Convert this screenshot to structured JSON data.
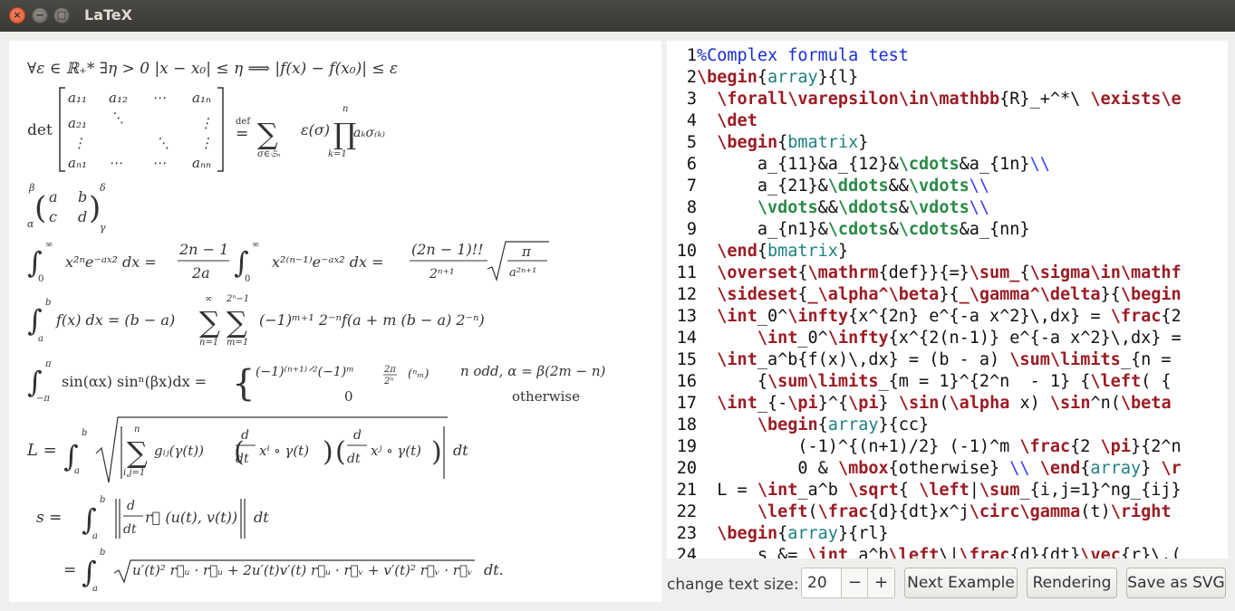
{
  "window": {
    "title": "LaTeX"
  },
  "editor": {
    "lines": [
      {
        "n": "1",
        "segs": [
          [
            "c-cmt",
            "%Complex formula test"
          ]
        ]
      },
      {
        "n": "2",
        "segs": [
          [
            "c-kw",
            "\\begin"
          ],
          [
            "code",
            "{"
          ],
          [
            "c-env",
            "array"
          ],
          [
            "code",
            "}{l}"
          ]
        ]
      },
      {
        "n": "3",
        "segs": [
          [
            "code",
            "  "
          ],
          [
            "c-kw",
            "\\forall\\varepsilon\\in\\mathbb"
          ],
          [
            "code",
            "{R}_+^*\\ "
          ],
          [
            "c-kw",
            "\\exists\\e"
          ]
        ]
      },
      {
        "n": "4",
        "segs": [
          [
            "code",
            "  "
          ],
          [
            "c-kw",
            "\\det"
          ]
        ]
      },
      {
        "n": "5",
        "segs": [
          [
            "code",
            "  "
          ],
          [
            "c-kw",
            "\\begin"
          ],
          [
            "code",
            "{"
          ],
          [
            "c-env",
            "bmatrix"
          ],
          [
            "code",
            "}"
          ]
        ]
      },
      {
        "n": "6",
        "segs": [
          [
            "code",
            "      a_{11}&a_{12}&"
          ],
          [
            "c-sym",
            "\\cdots"
          ],
          [
            "code",
            "&a_{1n}"
          ],
          [
            "c-br",
            "\\\\"
          ]
        ]
      },
      {
        "n": "7",
        "segs": [
          [
            "code",
            "      a_{21}&"
          ],
          [
            "c-sym",
            "\\ddots"
          ],
          [
            "code",
            "&&"
          ],
          [
            "c-sym",
            "\\vdots"
          ],
          [
            "c-br",
            "\\\\"
          ]
        ]
      },
      {
        "n": "8",
        "segs": [
          [
            "code",
            "      "
          ],
          [
            "c-sym",
            "\\vdots"
          ],
          [
            "code",
            "&&"
          ],
          [
            "c-sym",
            "\\ddots"
          ],
          [
            "code",
            "&"
          ],
          [
            "c-sym",
            "\\vdots"
          ],
          [
            "c-br",
            "\\\\"
          ]
        ]
      },
      {
        "n": "9",
        "segs": [
          [
            "code",
            "      a_{n1}&"
          ],
          [
            "c-sym",
            "\\cdots"
          ],
          [
            "code",
            "&"
          ],
          [
            "c-sym",
            "\\cdots"
          ],
          [
            "code",
            "&a_{nn}"
          ]
        ]
      },
      {
        "n": "10",
        "segs": [
          [
            "code",
            "  "
          ],
          [
            "c-kw",
            "\\end"
          ],
          [
            "code",
            "{"
          ],
          [
            "c-env",
            "bmatrix"
          ],
          [
            "code",
            "}"
          ]
        ]
      },
      {
        "n": "11",
        "segs": [
          [
            "code",
            "  "
          ],
          [
            "c-kw",
            "\\overset"
          ],
          [
            "code",
            "{"
          ],
          [
            "c-kw",
            "\\mathrm"
          ],
          [
            "code",
            "{def}}{=}"
          ],
          [
            "c-kw",
            "\\sum_"
          ],
          [
            "code",
            "{"
          ],
          [
            "c-kw",
            "\\sigma\\in\\mathf"
          ]
        ]
      },
      {
        "n": "12",
        "segs": [
          [
            "code",
            "  "
          ],
          [
            "c-kw",
            "\\sideset"
          ],
          [
            "code",
            "{"
          ],
          [
            "c-kw",
            "_\\alpha^\\beta"
          ],
          [
            "code",
            "}{"
          ],
          [
            "c-kw",
            "_\\gamma^\\delta"
          ],
          [
            "code",
            "}{"
          ],
          [
            "c-kw",
            "\\begin"
          ]
        ]
      },
      {
        "n": "13",
        "segs": [
          [
            "code",
            "  "
          ],
          [
            "c-kw",
            "\\int"
          ],
          [
            "code",
            "_0^"
          ],
          [
            "c-kw",
            "\\infty"
          ],
          [
            "code",
            "{x^{2n} e^{-a x^2}\\,dx} = "
          ],
          [
            "c-kw",
            "\\frac"
          ],
          [
            "code",
            "{2"
          ]
        ]
      },
      {
        "n": "14",
        "segs": [
          [
            "code",
            "      "
          ],
          [
            "c-kw",
            "\\int"
          ],
          [
            "code",
            "_0^"
          ],
          [
            "c-kw",
            "\\infty"
          ],
          [
            "code",
            "{x^{2(n-1)} e^{-a x^2}\\,dx} ="
          ]
        ]
      },
      {
        "n": "15",
        "segs": [
          [
            "code",
            "  "
          ],
          [
            "c-kw",
            "\\int"
          ],
          [
            "code",
            "_a^b{f(x)\\,dx} = (b - a) "
          ],
          [
            "c-kw",
            "\\sum\\limits"
          ],
          [
            "code",
            "_{n ="
          ]
        ]
      },
      {
        "n": "16",
        "segs": [
          [
            "code",
            "      {"
          ],
          [
            "c-kw",
            "\\sum\\limits"
          ],
          [
            "code",
            "_{m = 1}^{2^n  - 1} {"
          ],
          [
            "c-kw",
            "\\left"
          ],
          [
            "code",
            "( {"
          ]
        ]
      },
      {
        "n": "17",
        "segs": [
          [
            "code",
            "  "
          ],
          [
            "c-kw",
            "\\int"
          ],
          [
            "code",
            "_{-"
          ],
          [
            "c-kw",
            "\\pi"
          ],
          [
            "code",
            "}^{"
          ],
          [
            "c-kw",
            "\\pi"
          ],
          [
            "code",
            "} "
          ],
          [
            "c-kw",
            "\\sin"
          ],
          [
            "code",
            "("
          ],
          [
            "c-kw",
            "\\alpha"
          ],
          [
            "code",
            " x) "
          ],
          [
            "c-kw",
            "\\sin"
          ],
          [
            "code",
            "^n("
          ],
          [
            "c-kw",
            "\\beta"
          ]
        ]
      },
      {
        "n": "18",
        "segs": [
          [
            "code",
            "      "
          ],
          [
            "c-kw",
            "\\begin"
          ],
          [
            "code",
            "{"
          ],
          [
            "c-env",
            "array"
          ],
          [
            "code",
            "}{cc}"
          ]
        ]
      },
      {
        "n": "19",
        "segs": [
          [
            "code",
            "          (-1)^{(n+1)/2} (-1)^m "
          ],
          [
            "c-kw",
            "\\frac"
          ],
          [
            "code",
            "{2 "
          ],
          [
            "c-kw",
            "\\pi"
          ],
          [
            "code",
            "}{2^n"
          ]
        ]
      },
      {
        "n": "20",
        "segs": [
          [
            "code",
            "          0 & "
          ],
          [
            "c-kw",
            "\\mbox"
          ],
          [
            "code",
            "{otherwise} "
          ],
          [
            "c-br",
            "\\\\"
          ],
          [
            "code",
            " "
          ],
          [
            "c-kw",
            "\\end"
          ],
          [
            "code",
            "{"
          ],
          [
            "c-env",
            "array"
          ],
          [
            "code",
            "} "
          ],
          [
            "c-kw",
            "\\r"
          ]
        ]
      },
      {
        "n": "21",
        "segs": [
          [
            "code",
            "  L = "
          ],
          [
            "c-kw",
            "\\int"
          ],
          [
            "code",
            "_a^b "
          ],
          [
            "c-kw",
            "\\sqrt"
          ],
          [
            "code",
            "{ "
          ],
          [
            "c-kw",
            "\\left"
          ],
          [
            "code",
            "|"
          ],
          [
            "c-kw",
            "\\sum"
          ],
          [
            "code",
            "_{i,j=1}^ng_{ij}"
          ]
        ]
      },
      {
        "n": "22",
        "segs": [
          [
            "code",
            "      "
          ],
          [
            "c-kw",
            "\\left"
          ],
          [
            "code",
            "("
          ],
          [
            "c-kw",
            "\\frac"
          ],
          [
            "code",
            "{d}{dt}x^j"
          ],
          [
            "c-kw",
            "\\circ\\gamma"
          ],
          [
            "code",
            "(t)"
          ],
          [
            "c-kw",
            "\\right"
          ]
        ]
      },
      {
        "n": "23",
        "segs": [
          [
            "code",
            "  "
          ],
          [
            "c-kw",
            "\\begin"
          ],
          [
            "code",
            "{"
          ],
          [
            "c-env",
            "array"
          ],
          [
            "code",
            "}{rl}"
          ]
        ]
      },
      {
        "n": "24",
        "segs": [
          [
            "code",
            "      s &= "
          ],
          [
            "c-kw",
            "\\int"
          ],
          [
            "code",
            "_a^b"
          ],
          [
            "c-kw",
            "\\left"
          ],
          [
            "code",
            "\\|"
          ],
          [
            "c-kw",
            "\\frac"
          ],
          [
            "code",
            "{d}{dt}"
          ],
          [
            "c-kw",
            "\\vec"
          ],
          [
            "code",
            "{r}\\,("
          ]
        ]
      }
    ]
  },
  "controls": {
    "size_label": "change text size:",
    "size_value": "20",
    "minus": "−",
    "plus": "+",
    "next_label": "Next Example",
    "render_label": "Rendering",
    "svg_label": "Save as SVG"
  },
  "formula": {
    "line1": "∀ε ∈ ℝ₊* ∃η > 0 |x − x₀| ≤ η ⟹ |f(x) − f(x₀)| ≤ ε",
    "det": "det",
    "def": "def",
    "matrix": [
      [
        "a₁₁",
        "a₁₂",
        "⋯",
        "a₁ₙ"
      ],
      [
        "a₂₁",
        "⋱",
        "",
        "⋮"
      ],
      [
        "⋮",
        "",
        "⋱",
        "⋮"
      ],
      [
        "aₙ₁",
        "⋯",
        "⋯",
        "aₙₙ"
      ]
    ],
    "sumexpr": "ε(σ)",
    "prodexpr": "aₖσ₍ₖ₎",
    "side": [
      "β",
      "δ",
      "α",
      "γ",
      "a",
      "b",
      "c",
      "d"
    ],
    "int1": "x²ⁿe⁻ᵃˣ² dx =",
    "frac1": [
      "2n − 1",
      "2a"
    ],
    "int1b": "x²⁽ⁿ⁻¹⁾e⁻ᵃˣ² dx =",
    "frac2": [
      "(2n − 1)!!",
      "2ⁿ⁺¹"
    ],
    "sqrtfrac": [
      "π",
      "a²ⁿ⁺¹"
    ],
    "l5": "f(x) dx = (b − a)",
    "l5b": "(−1)ᵐ⁺¹ 2⁻ⁿf(a + m (b − a) 2⁻ⁿ)",
    "l6": "sin(αx) sinⁿ(βx)dx =",
    "l6c1": "(−1)⁽ⁿ⁺¹⁾ᐟ²(−1)ᵐ",
    "l6c1b": "n odd,  α = β(2m − n)",
    "l6c2": "0",
    "l6c2b": "otherwise",
    "l7": "L =",
    "l7b": "gᵢⱼ(γ(t))",
    "l7c": "xⁱ ∘ γ(t)",
    "l7d": "xʲ ∘ γ(t)",
    "l8": "s   =",
    "l8b": "r⃗ (u(t), v(t))",
    "l9": "=",
    "l9b": "u′(t)² r⃗ᵤ · r⃗ᵤ + 2u′(t)v′(t) r⃗ᵤ · r⃗ᵥ + v′(t)² r⃗ᵥ · r⃗ᵥ",
    "dt": "dt",
    "dt2": "dt.",
    "lim": [
      "∞",
      "n=1",
      "2ⁿ−1",
      "m=1",
      "n",
      "σ∈𝔖ₙ",
      "k=1",
      "i,j=1",
      "0",
      "a",
      "b",
      "π",
      "−π"
    ]
  }
}
